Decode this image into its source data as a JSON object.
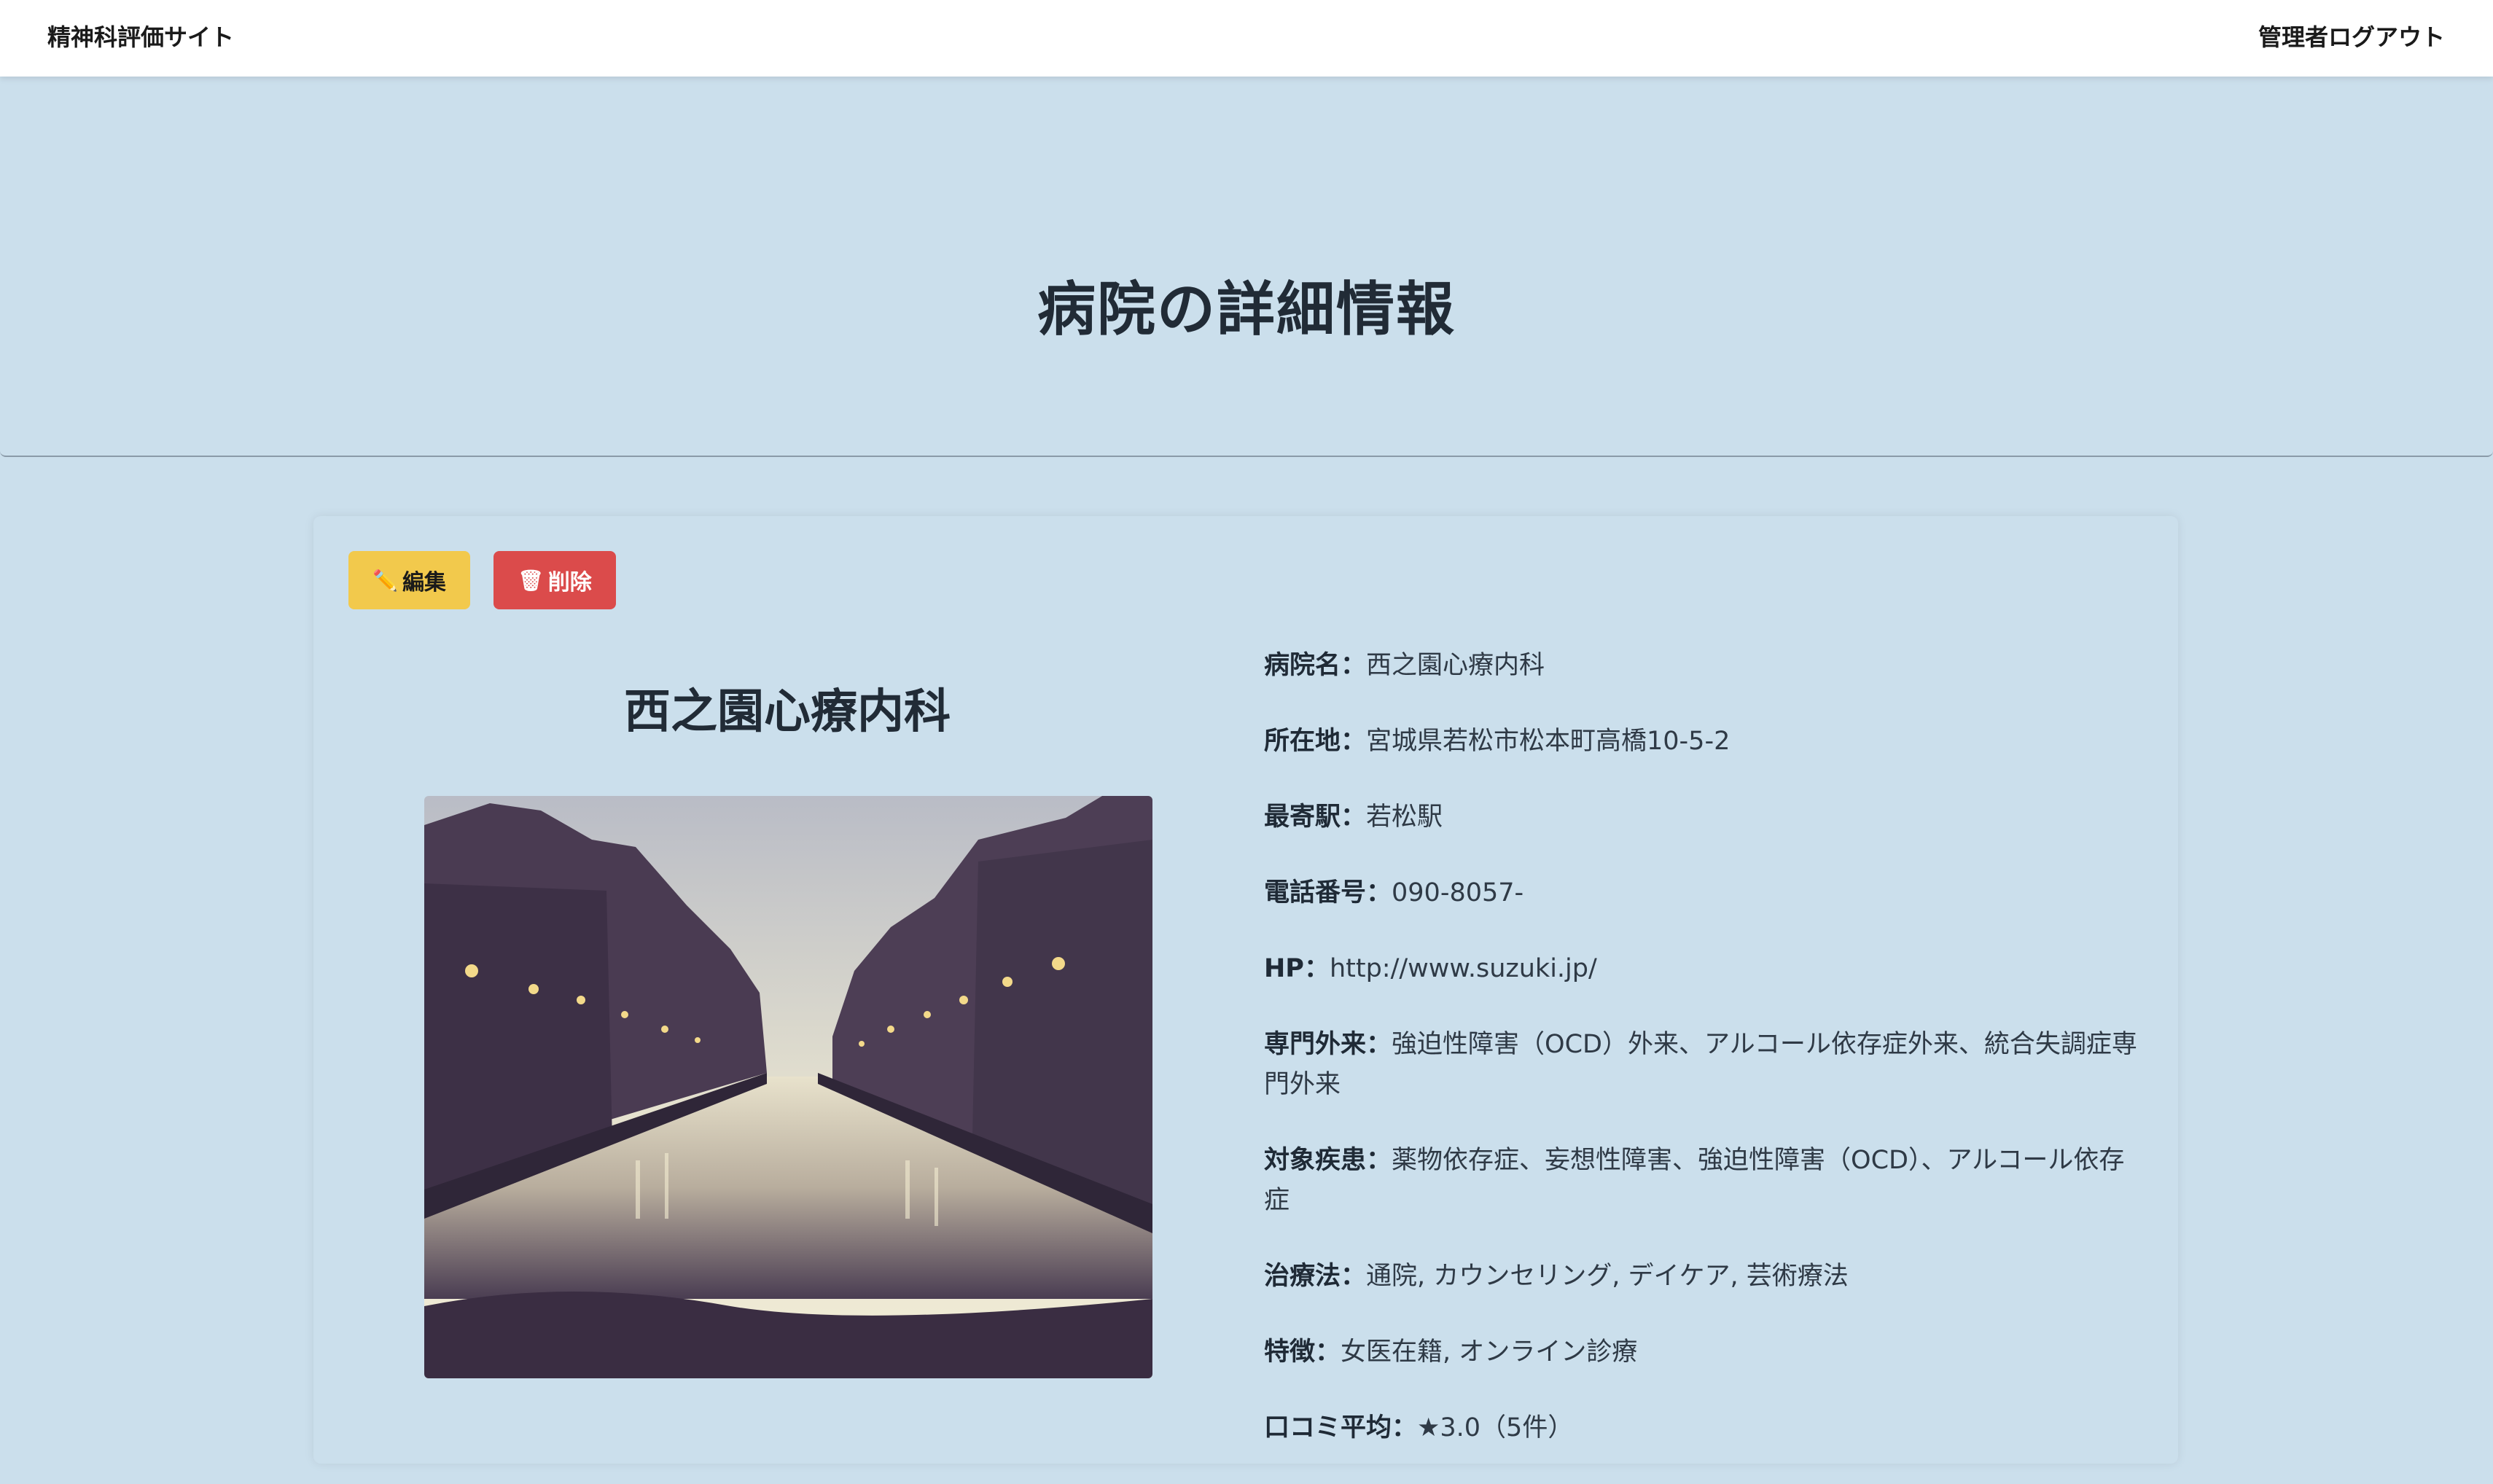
{
  "nav": {
    "brand": "精神科評価サイト",
    "logout": "管理者ログアウト"
  },
  "hero": {
    "title": "病院の詳細情報"
  },
  "actions": {
    "edit_icon": "✏️",
    "edit_label": "編集",
    "delete_icon": "🗑",
    "delete_label": "削除"
  },
  "hospital": {
    "name": "西之園心療内科",
    "image_alt": "canal-at-dusk-photo",
    "fields": [
      {
        "label": "病院名：",
        "value": "西之園心療内科"
      },
      {
        "label": "所在地：",
        "value": "宮城県若松市松本町高橋10-5-2"
      },
      {
        "label": "最寄駅：",
        "value": "若松駅"
      },
      {
        "label": "電話番号：",
        "value": "090-8057-"
      },
      {
        "label": "HP：",
        "value": "http://www.suzuki.jp/"
      },
      {
        "label": "専門外来：",
        "value": "強迫性障害（OCD）外来、アルコール依存症外来、統合失調症専門外来"
      },
      {
        "label": "対象疾患：",
        "value": "薬物依存症、妄想性障害、強迫性障害（OCD）、アルコール依存症"
      },
      {
        "label": "治療法：",
        "value": "通院, カウンセリング, デイケア, 芸術療法"
      },
      {
        "label": "特徴：",
        "value": "女医在籍, オンライン診療"
      },
      {
        "label": "口コミ平均：",
        "value": "★3.0（5件）"
      }
    ]
  },
  "colors": {
    "background": "#cbdfec",
    "edit": "#f2c94c",
    "delete": "#db4b4b"
  }
}
